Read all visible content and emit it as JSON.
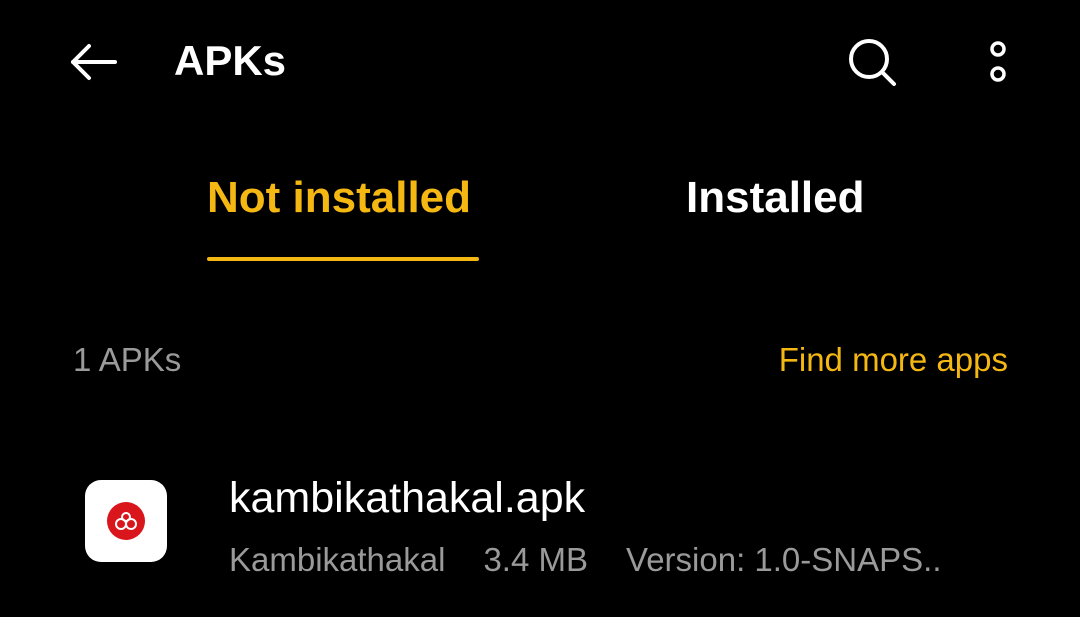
{
  "header": {
    "title": "APKs",
    "icons": {
      "back": "arrow-left-icon",
      "search": "search-icon",
      "more": "more-vertical-icon"
    }
  },
  "tabs": [
    {
      "label": "Not installed",
      "selected": true
    },
    {
      "label": "Installed",
      "selected": false
    }
  ],
  "list": {
    "count_label": "1 APKs",
    "find_more_label": "Find more apps",
    "items": [
      {
        "file_name": "kambikathakal.apk",
        "app_name": "Kambikathakal",
        "size": "3.4 MB",
        "version": "Version: 1.0-SNAPS..",
        "icon": "kambikathakal-app-icon"
      }
    ]
  },
  "colors": {
    "background": "#000000",
    "accent": "#f5b712",
    "primary_text": "#ffffff",
    "secondary_text": "#9a9a9a",
    "app_icon_red": "#d9161c"
  }
}
